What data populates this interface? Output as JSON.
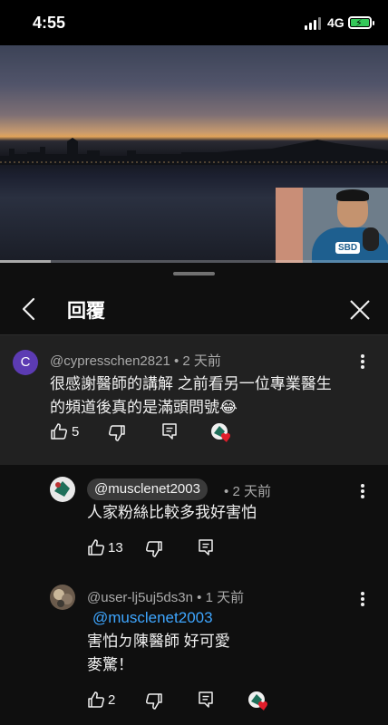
{
  "status_bar": {
    "time": "4:55",
    "network": "4G"
  },
  "video": {
    "progress": 0.13
  },
  "sheet": {
    "title": "回覆"
  },
  "parent_comment": {
    "avatar_letter": "C",
    "author": "@cypresschen2821",
    "time": "2 天前",
    "text_line1": "很感謝醫師的講解 之前看另一位專業醫生",
    "text_line2": "的頻道後真的是滿頭問號😂",
    "likes": "5"
  },
  "replies": [
    {
      "author": "@musclenet2003",
      "time": "2 天前",
      "text": "人家粉絲比較多我好害怕",
      "likes": "13"
    },
    {
      "author": "@user-lj5uj5ds3n",
      "time": "1 天前",
      "mention": "@musclenet2003",
      "text_line1": "害怕ㄉ陳醫師 好可愛",
      "text_line2": "麥驚！",
      "likes": "2"
    }
  ],
  "separator": "•",
  "colors": {
    "background": "#0f0f0f",
    "highlight_bg": "#212121",
    "link": "#3ea6ff",
    "avatar_purple": "#5c3bb3",
    "heart": "#e11d2a"
  },
  "icons": [
    "back-arrow-icon",
    "close-icon",
    "more-vert-icon",
    "thumb-up-icon",
    "thumb-down-icon",
    "reply-comment-icon",
    "creator-heart-icon"
  ]
}
